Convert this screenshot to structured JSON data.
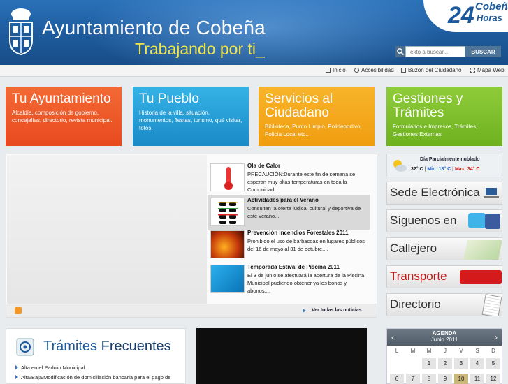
{
  "header": {
    "title": "Ayuntamiento de Cobeña",
    "tagline": "Trabajando por ti_",
    "logo_number": "24",
    "logo_line1": "Cobeña",
    "logo_line2": "Horas"
  },
  "search": {
    "placeholder": "Texto a buscar...",
    "button": "BUSCAR"
  },
  "utility": [
    "Inicio",
    "Accesibilidad",
    "Buzón del Ciudadano",
    "Mapa Web"
  ],
  "tiles": [
    {
      "title": "Tu Ayuntamiento",
      "text": "Alcaldía, composición de gobierno, concejalías, directorio, revista municipal."
    },
    {
      "title": "Tu Pueblo",
      "text": "Historia de la villa, situación, monumentos, fiestas, turismo, qué visitar, fotos."
    },
    {
      "title": "Servicios al Ciudadano",
      "text": "Biblioteca, Punto Limpio, Polideportivo, Policía Local etc.."
    },
    {
      "title": "Gestiones y Trámites",
      "text": "Formularios e Impresos, Trámites, Gestiones Externas"
    }
  ],
  "news": {
    "items": [
      {
        "title": "Ola de Calor",
        "text": "PRECAUCIÓN:Durante este fin de semana se esperan muy altas temperaturas en toda la Comunidad..."
      },
      {
        "title": "Actividades para el Verano",
        "text": "Consulten la oferta lúdica, cultural y deportiva de este verano..."
      },
      {
        "title": "Prevención Incendios Forestales 2011",
        "text": "Prohibido el uso de barbacoas en lugares públicos del 16 de mayo al 31 de octubre...."
      },
      {
        "title": "Temporada Estival de Piscina 2011",
        "text": "El 3 de junio se afectuará la apertura de la Piscina Municipal pudiendo obtener ya los bonos y abonos...."
      }
    ],
    "see_all": "Ver todas las noticias"
  },
  "weather": {
    "desc": "Día Parcialmente nublado",
    "current": "32° C",
    "min": "Min: 18° C",
    "max": "Max: 34° C"
  },
  "banners": [
    "Sede Electrónica",
    "Síguenos en",
    "Callejero",
    "Transporte",
    "Directorio"
  ],
  "tramites": {
    "title1": "Trámites",
    "title2": "Frecuentes",
    "items": [
      "Alta en el Padrón Municipal",
      "Alta/Baja/Modificación de domiciliación bancaria para el pago de"
    ]
  },
  "calendar": {
    "title": "AGENDA",
    "month": "Junio 2011",
    "dow": [
      "L",
      "M",
      "M",
      "J",
      "V",
      "S",
      "D"
    ],
    "row1": [
      "",
      "",
      "1",
      "2",
      "3",
      "4",
      "5"
    ],
    "row2": [
      "6",
      "7",
      "8",
      "9",
      "10",
      "11",
      "12"
    ]
  },
  "colors": {
    "header": "#1d5a9c",
    "tagline": "#f1e64a",
    "orange": "#e8491e",
    "blue": "#1a8ac7",
    "yellow": "#f09d10",
    "green": "#6eb11f"
  }
}
